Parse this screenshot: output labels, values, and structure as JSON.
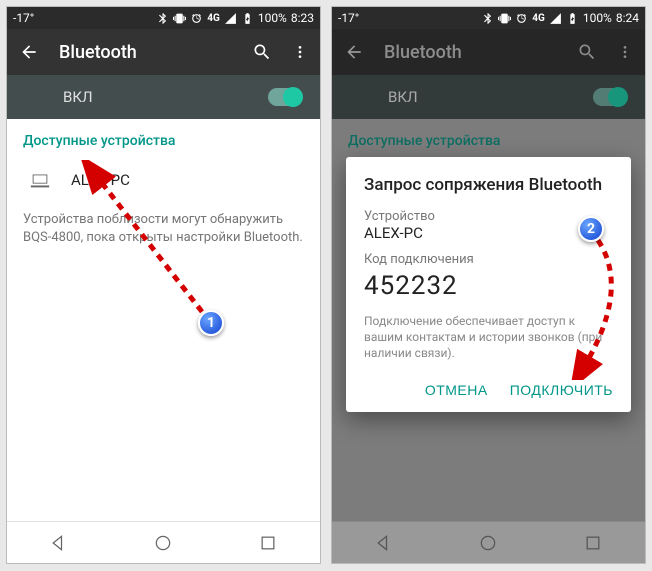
{
  "left": {
    "status": {
      "temp": "-17°",
      "battery": "100%",
      "time": "8:23"
    },
    "appbar": {
      "title": "Bluetooth"
    },
    "toggle": {
      "label": "ВКЛ"
    },
    "section": "Доступные устройства",
    "device": {
      "name": "ALEX-PC"
    },
    "hint": "Устройства поблизости могут обнаружить BQS-4800, пока открыты настройки Bluetooth."
  },
  "right": {
    "status": {
      "temp": "-17°",
      "battery": "100%",
      "time": "8:24"
    },
    "appbar": {
      "title": "Bluetooth"
    },
    "toggle": {
      "label": "ВКЛ"
    },
    "section": "Доступные устройства",
    "dialog": {
      "title": "Запрос сопряжения Bluetooth",
      "device_label": "Устройство",
      "device": "ALEX-PC",
      "code_label": "Код подключения",
      "code": "452232",
      "note": "Подключение обеспечивает доступ к вашим контактам и истории звонков (при наличии связи).",
      "cancel": "ОТМЕНА",
      "pair": "ПОДКЛЮЧИТЬ"
    }
  },
  "badges": {
    "one": "1",
    "two": "2"
  }
}
